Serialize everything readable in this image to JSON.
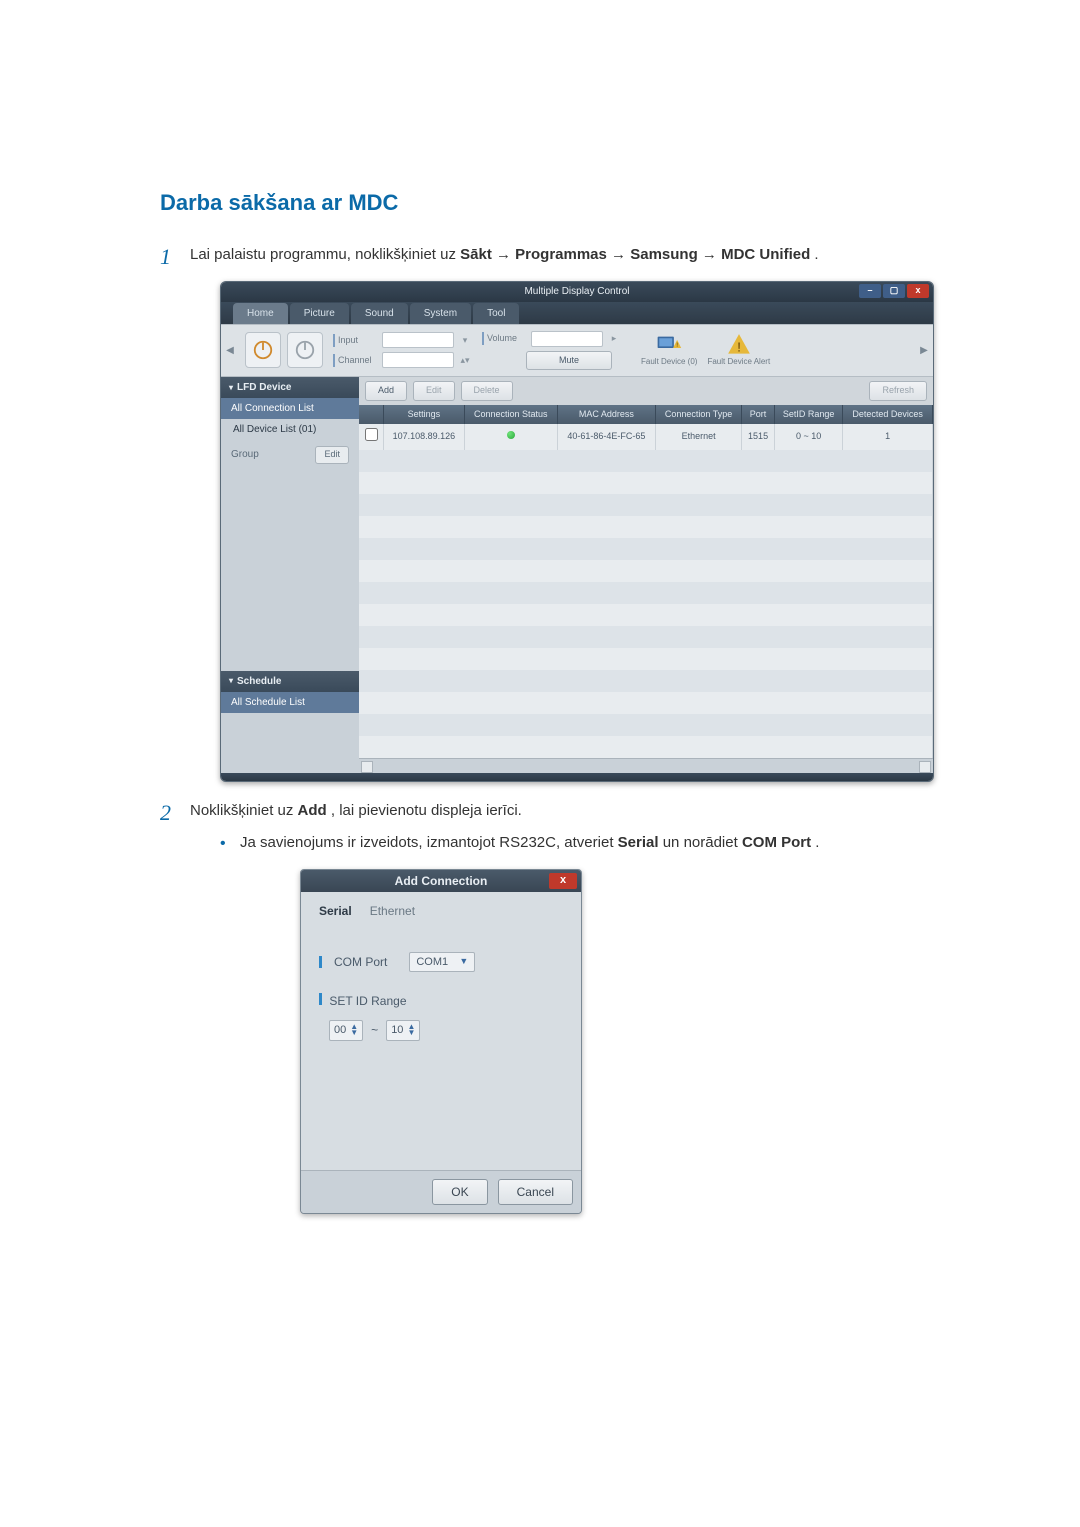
{
  "title": "Darba sākšana ar MDC",
  "step1": {
    "num": "1",
    "pre": "Lai palaistu programmu, noklikšķiniet uz ",
    "b1": "Sākt",
    "arr": " → ",
    "b2": "Programmas",
    "b3": "Samsung",
    "b4": "MDC Unified",
    "post": "."
  },
  "step2": {
    "num": "2",
    "pre": "Noklikšķiniet uz ",
    "b1": "Add",
    "post": ", lai pievienotu displeja ierīci."
  },
  "sub1": {
    "pre": "Ja savienojums ir izveidots, izmantojot RS232C, atveriet ",
    "b1": "Serial",
    "mid": " un norādiet ",
    "b2": "COM Port",
    "post": "."
  },
  "mdc": {
    "windowTitle": "Multiple Display Control",
    "help": "?",
    "tabs": {
      "home": "Home",
      "picture": "Picture",
      "sound": "Sound",
      "system": "System",
      "tool": "Tool"
    },
    "toolbar": {
      "inputLabel": "Input",
      "channelLabel": "Channel",
      "volumeLabel": "Volume",
      "muteLabel": "Mute",
      "fault0": "Fault Device (0)",
      "fault1": "Fault Device Alert"
    },
    "mainbar": {
      "add": "Add",
      "edit": "Edit",
      "delete": "Delete",
      "refresh": "Refresh"
    },
    "side": {
      "lfd": "LFD Device",
      "allConn": "All Connection List",
      "allDev": "All Device List (01)",
      "group": "Group",
      "editBtn": "Edit",
      "schedule": "Schedule",
      "allSched": "All Schedule List"
    },
    "cols": {
      "chk": "",
      "settings": "Settings",
      "conn": "Connection Status",
      "mac": "MAC Address",
      "ctype": "Connection Type",
      "port": "Port",
      "setid": "SetID Range",
      "det": "Detected Devices"
    },
    "row": {
      "settings": "107.108.89.126",
      "mac": "40-61-86-4E-FC-65",
      "ctype": "Ethernet",
      "port": "1515",
      "setid": "0 ~ 10",
      "det": "1"
    }
  },
  "dlg": {
    "title": "Add Connection",
    "tabSerial": "Serial",
    "tabEth": "Ethernet",
    "comPortLabel": "COM Port",
    "comPortValue": "COM1",
    "setIdLabel": "SET ID Range",
    "rangeFrom": "00",
    "rangeSep": "~",
    "rangeTo": "10",
    "ok": "OK",
    "cancel": "Cancel"
  }
}
